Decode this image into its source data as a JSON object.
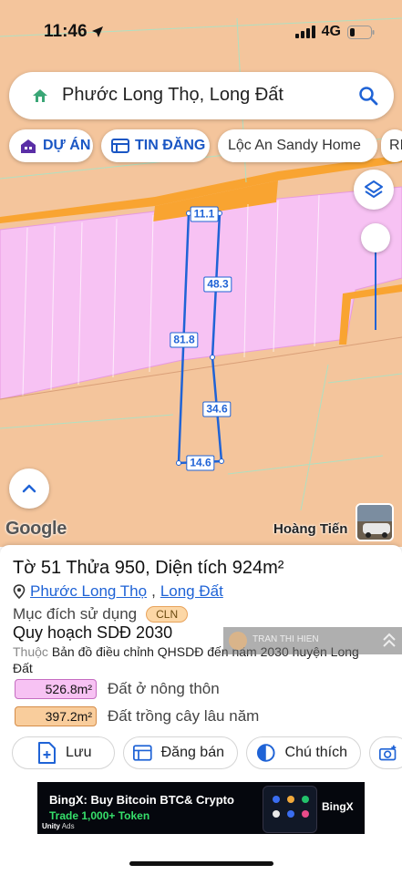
{
  "status_bar": {
    "time": "11:46",
    "network": "4G"
  },
  "search": {
    "query": "Phước Long Thọ, Long Đất"
  },
  "filter_chips": [
    {
      "label": "DỰ ÁN",
      "icon": "building-icon"
    },
    {
      "label": "TIN ĐĂNG",
      "icon": "listing-icon"
    },
    {
      "label": "Lộc An Sandy Home"
    },
    {
      "label": "RI"
    }
  ],
  "map": {
    "measurements": {
      "top": "11.1",
      "upper_right": "48.3",
      "left": "81.8",
      "lower_right": "34.6",
      "bottom": "14.6"
    },
    "attribution": "Google",
    "place_label": "Hoàng Tiến",
    "colors": {
      "residential": "#f7c2f3",
      "perennial": "#f4c59c",
      "road": "#f9a431",
      "boundary": "#1f63d6"
    }
  },
  "parcel": {
    "title": "Tờ 51 Thửa 950, Diện tích 924m²",
    "commune": "Phước Long Thọ",
    "separator": ",",
    "district": "Long Đất",
    "purpose_label": "Mục đích sử dụng",
    "purpose_code": "CLN",
    "plan_title": "Quy hoạch SDĐ 2030",
    "plan_prefix": "Thuộc",
    "plan_desc": "Bản đồ điều chỉnh QHSDĐ đến năm 2030 huyện Long Đất",
    "overlay_name": "TRAN THI HIEN",
    "areas": [
      {
        "value": "526.8m²",
        "label": "Đất ở nông thôn",
        "color": "#f7c2f3",
        "border": "#c56dc1"
      },
      {
        "value": "397.2m²",
        "label": "Đất trồng cây lâu năm",
        "color": "#f9cd9c",
        "border": "#d58c48"
      }
    ]
  },
  "actions": {
    "save": "Lưu",
    "post": "Đăng bán",
    "legend": "Chú thích"
  },
  "ad": {
    "title": "BingX: Buy Bitcoin BTC& Crypto",
    "subtitle": "Trade 1,000+ Token",
    "network": "Unity",
    "network_suffix": "Ads",
    "logo": "BingX"
  }
}
